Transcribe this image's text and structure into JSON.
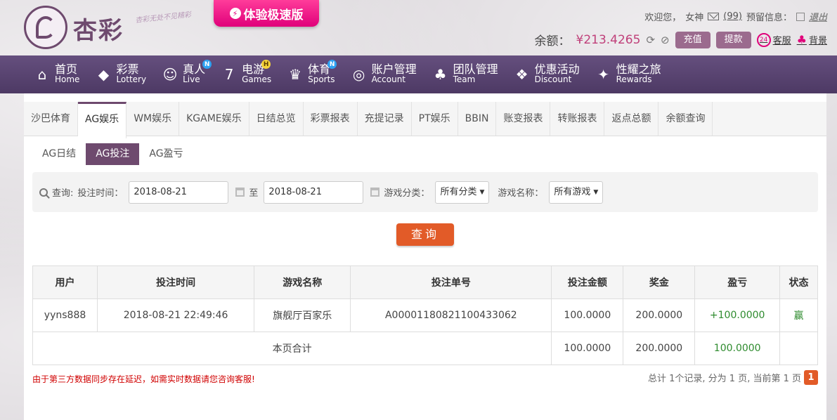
{
  "header": {
    "brand": "杏彩",
    "slogan": "杏彩无处不见精彩",
    "promo": "体验极速版",
    "welcome_label": "欢迎您，",
    "username": "女神",
    "messages": "(99)",
    "reserved_info": "预留信息：",
    "logout": "退出",
    "balance_label": "余额：",
    "balance_value": "¥213.4265",
    "deposit": "充值",
    "withdraw": "提款",
    "support": "客服",
    "background": "背景"
  },
  "nav": [
    {
      "zh": "首页",
      "en": "Home",
      "icon": "home-icon",
      "badge": ""
    },
    {
      "zh": "彩票",
      "en": "Lottery",
      "icon": "lottery-icon",
      "badge": ""
    },
    {
      "zh": "真人",
      "en": "Live",
      "icon": "live-icon",
      "badge": "N"
    },
    {
      "zh": "电游",
      "en": "Games",
      "icon": "games-icon",
      "badge": "H"
    },
    {
      "zh": "体育",
      "en": "Sports",
      "icon": "trophy-icon",
      "badge": "N"
    },
    {
      "zh": "账户管理",
      "en": "Account",
      "icon": "account-icon",
      "badge": ""
    },
    {
      "zh": "团队管理",
      "en": "Team",
      "icon": "team-icon",
      "badge": ""
    },
    {
      "zh": "优惠活动",
      "en": "Discount",
      "icon": "gift-icon",
      "badge": ""
    },
    {
      "zh": "性耀之旅",
      "en": "Rewards",
      "icon": "rewards-icon",
      "badge": ""
    }
  ],
  "tabs": [
    "沙巴体育",
    "AG娱乐",
    "WM娱乐",
    "KGAME娱乐",
    "日结总览",
    "彩票报表",
    "充提记录",
    "PT娱乐",
    "BBIN",
    "账变报表",
    "转账报表",
    "返点总额",
    "余额查询"
  ],
  "subtabs": [
    "AG日结",
    "AG投注",
    "AG盈亏"
  ],
  "filter": {
    "query_label": "查询:",
    "time_label": "投注时间：",
    "start_date": "2018-08-21",
    "to_label": "至",
    "end_date": "2018-08-21",
    "category_label": "游戏分类：",
    "category_value": "所有分类",
    "game_label": "游戏名称：",
    "game_value": "所有游戏",
    "query_button": "查询"
  },
  "table": {
    "headers": [
      "用户",
      "投注时间",
      "游戏名称",
      "投注单号",
      "投注金额",
      "奖金",
      "盈亏",
      "状态"
    ],
    "row": [
      "yyns888",
      "2018-08-21 22:49:46",
      "旗舰厅百家乐",
      "A00001180821100433062",
      "100.0000",
      "200.0000",
      "+100.0000",
      "赢"
    ],
    "total_label": "本页合计",
    "total_amount": "100.0000",
    "total_bonus": "200.0000",
    "total_profit": "100.0000"
  },
  "note": "由于第三方数据同步存在延迟，如需实时数据请您咨询客服!",
  "pager": {
    "summary": "总计 1个记录, 分为 1 页, 当前第 1 页",
    "page": "1"
  },
  "colors": {
    "accent": "#6e4a6e",
    "orange": "#e25b28",
    "nav": "#5a4472"
  }
}
